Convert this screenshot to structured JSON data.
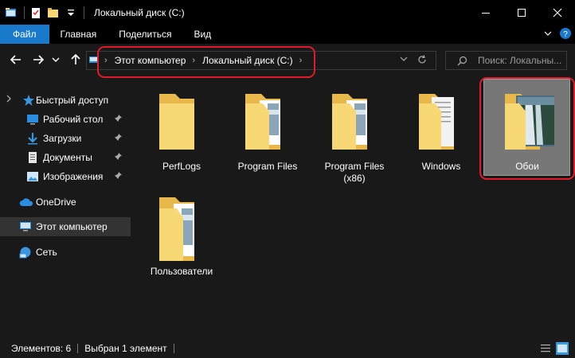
{
  "window": {
    "title": "Локальный диск (C:)",
    "minimize_glyph": "—",
    "maximize_glyph": "☐",
    "close_glyph": "✕"
  },
  "ribbon": {
    "tabs": [
      "Файл",
      "Главная",
      "Поделиться",
      "Вид"
    ],
    "collapse_glyph": "⌄",
    "help_glyph": "?"
  },
  "address": {
    "crumbs": [
      "Этот компьютер",
      "Локальный диск (C:)"
    ],
    "search_placeholder": "Поиск: Локальны..."
  },
  "sidebar": {
    "quick_access": "Быстрый доступ",
    "items": [
      {
        "label": "Рабочий стол",
        "icon": "desktop-icon",
        "pinned": true
      },
      {
        "label": "Загрузки",
        "icon": "downloads-icon",
        "pinned": true
      },
      {
        "label": "Документы",
        "icon": "documents-icon",
        "pinned": true
      },
      {
        "label": "Изображения",
        "icon": "pictures-icon",
        "pinned": true
      }
    ],
    "onedrive": "OneDrive",
    "this_pc": "Этот компьютер",
    "network": "Сеть"
  },
  "content": {
    "items": [
      {
        "name": "PerfLogs",
        "type": "folder"
      },
      {
        "name": "Program Files",
        "type": "folder-files"
      },
      {
        "name": "Program Files (x86)",
        "type": "folder-files"
      },
      {
        "name": "Windows",
        "type": "folder-docs"
      },
      {
        "name": "Обои",
        "type": "folder-image",
        "selected": true
      },
      {
        "name": "Пользователи",
        "type": "folder-files"
      }
    ]
  },
  "status": {
    "count": "Элементов: 6",
    "selection": "Выбран 1 элемент"
  },
  "colors": {
    "accent": "#1979ca",
    "highlight": "#e21b2a",
    "folder": "#f8d775",
    "folder_dark": "#e8b94a"
  }
}
